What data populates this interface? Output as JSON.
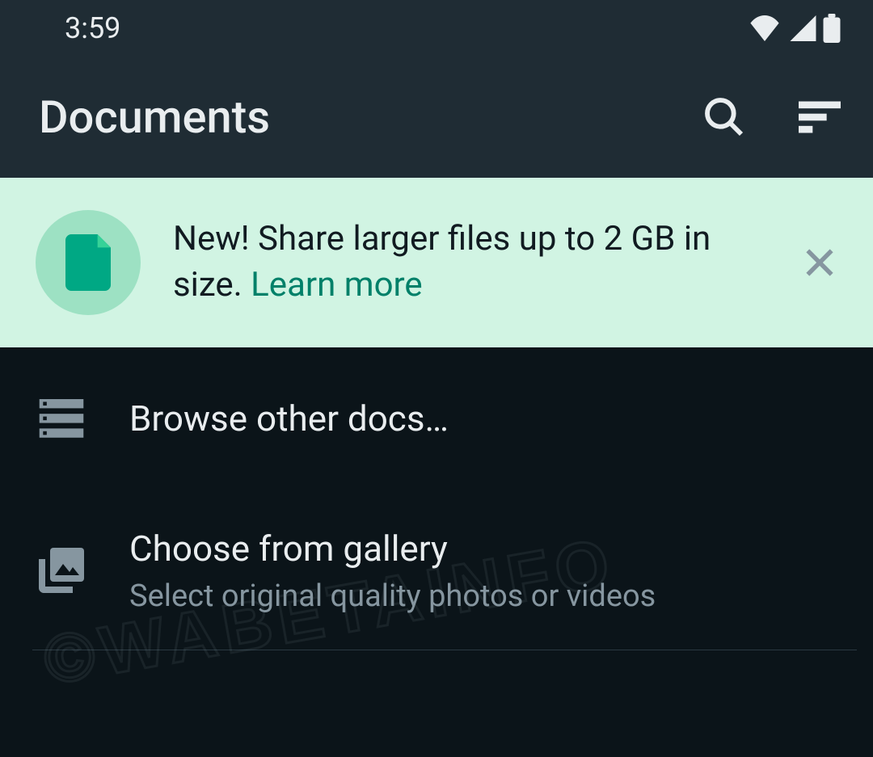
{
  "status": {
    "time": "3:59"
  },
  "appbar": {
    "title": "Documents"
  },
  "banner": {
    "text": "New! Share larger files up to 2 GB in size. ",
    "link": "Learn more"
  },
  "items": {
    "browse": {
      "title": "Browse other docs…"
    },
    "gallery": {
      "title": "Choose from gallery",
      "subtitle": "Select original quality photos or videos"
    }
  },
  "watermark": "©WABETAINFO"
}
